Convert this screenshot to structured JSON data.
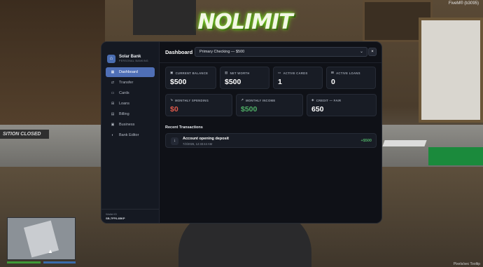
{
  "logo": {
    "text": "NOLIMIT"
  },
  "hud": {
    "top_right": "FiveM® (b3095)",
    "bottom_right": "Pixels/sec Tooltip"
  },
  "background": {
    "sign_text": "SITION CLOSED"
  },
  "app": {
    "brand": {
      "name": "Solar Bank",
      "subtitle": "PERSONAL BANKING",
      "icon": "bank-icon"
    },
    "nav": [
      {
        "label": "Dashboard",
        "icon": "dashboard-icon",
        "active": true
      },
      {
        "label": "Transfer",
        "icon": "transfer-icon",
        "active": false
      },
      {
        "label": "Cards",
        "icon": "card-icon",
        "active": false
      },
      {
        "label": "Loans",
        "icon": "loan-icon",
        "active": false
      },
      {
        "label": "Billing",
        "icon": "billing-icon",
        "active": false
      },
      {
        "label": "Business",
        "icon": "business-icon",
        "active": false
      },
      {
        "label": "Bank Editor",
        "icon": "palette-icon",
        "active": false
      }
    ],
    "wallet": {
      "label": "Wallet ID",
      "id": "SB-7FF6-85KP"
    },
    "header": {
      "title": "Dashboard",
      "account_selected": "Primary Checking — $500",
      "close_label": "×"
    },
    "stats_top": [
      {
        "label": "CURRENT BALANCE",
        "value": "$500",
        "icon": "wallet-icon"
      },
      {
        "label": "NET WORTH",
        "value": "$500",
        "icon": "chart-icon"
      },
      {
        "label": "ACTIVE CARDS",
        "value": "1",
        "icon": "card-icon"
      },
      {
        "label": "ACTIVE LOANS",
        "value": "0",
        "icon": "loan-icon"
      }
    ],
    "stats_bottom": [
      {
        "label": "MONTHLY SPENDING",
        "value": "$0",
        "icon": "trend-down-icon",
        "color": "#e05a4b"
      },
      {
        "label": "MONTHLY INCOME",
        "value": "$500",
        "icon": "trend-up-icon",
        "color": "#4fae66"
      },
      {
        "label": "CREDIT — FAIR",
        "value": "650",
        "icon": "shield-icon",
        "color": "#ffffff"
      }
    ],
    "transactions": {
      "title": "Recent Transactions",
      "items": [
        {
          "title": "Account opening deposit",
          "date": "7/2/2026, 12:33:44 AM",
          "amount": "+$500",
          "icon": "arrow-down-icon"
        }
      ]
    },
    "accent": "#4f6fb6"
  }
}
